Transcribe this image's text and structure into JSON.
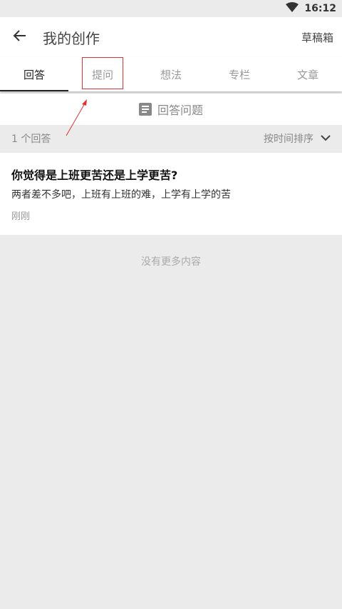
{
  "status": {
    "time": "16:12",
    "wifi_icon": "wifi-icon"
  },
  "header": {
    "title": "我的创作",
    "drafts_label": "草稿箱",
    "back_icon": "back-arrow-icon"
  },
  "tabs": [
    {
      "label": "回答",
      "active": true
    },
    {
      "label": "提问",
      "active": false
    },
    {
      "label": "想法",
      "active": false
    },
    {
      "label": "专栏",
      "active": false
    },
    {
      "label": "文章",
      "active": false
    }
  ],
  "answer_action": {
    "label": "回答问题",
    "icon": "document-icon"
  },
  "list_header": {
    "count_label": "1 个回答",
    "sort_label": "按时间排序",
    "sort_icon": "chevron-down-icon"
  },
  "items": [
    {
      "title": "你觉得是上班更苦还是上学更苦?",
      "excerpt": "两者差不多吧，上班有上班的难，上学有上学的苦",
      "time": "刚刚"
    }
  ],
  "footer": {
    "no_more": "没有更多内容"
  },
  "colors": {
    "annotation": "#dd3333",
    "background": "#ebebeb",
    "accent": "#222222"
  }
}
